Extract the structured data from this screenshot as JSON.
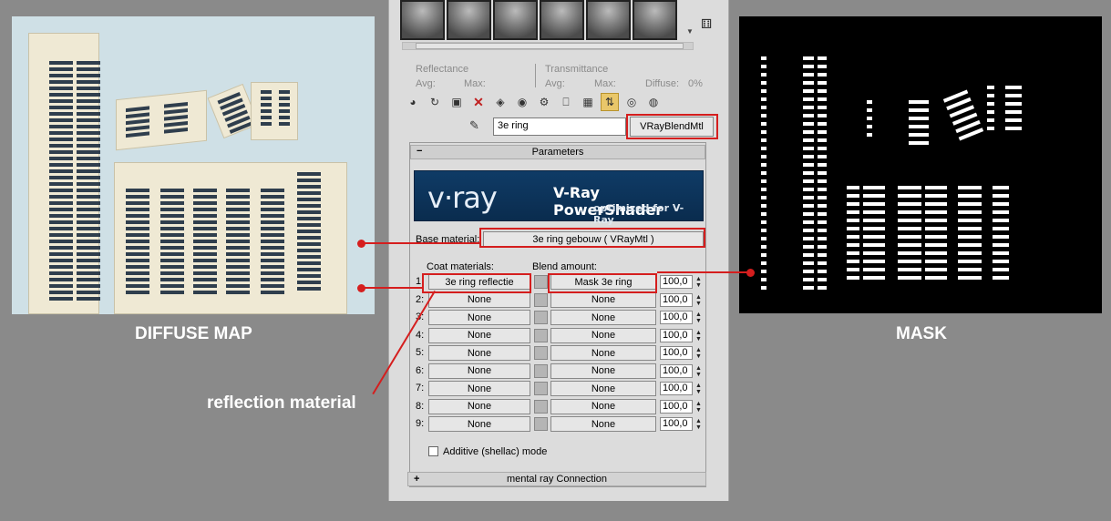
{
  "captions": {
    "diffuse": "DIFFUSE MAP",
    "mask": "MASK",
    "reflection": "reflection material"
  },
  "top": {
    "reflectance": "Reflectance",
    "transmittance": "Transmittance",
    "avg1": "Avg:",
    "max1": "Max:",
    "avg2": "Avg:",
    "max2": "Max:",
    "diffuse": "Diffuse:",
    "diffuse_val": "0%"
  },
  "material": {
    "name": "3e ring",
    "type": "VRayBlendMtl"
  },
  "parameters": {
    "header": "Parameters",
    "collapse": "−",
    "vray_logo": "v·ray",
    "vray_title": "V-Ray PowerShader",
    "vray_subtitle": "optimized for V-Ray",
    "base_label": "Base material:",
    "base_value": "3e ring gebouw  ( VRayMtl )",
    "coat_header": "Coat materials:",
    "blend_header": "Blend amount:",
    "rows": [
      {
        "n": "1:",
        "coat": "3e ring reflectie",
        "blend": "Mask 3e ring",
        "amt": "100,0"
      },
      {
        "n": "2:",
        "coat": "None",
        "blend": "None",
        "amt": "100,0"
      },
      {
        "n": "3:",
        "coat": "None",
        "blend": "None",
        "amt": "100,0"
      },
      {
        "n": "4:",
        "coat": "None",
        "blend": "None",
        "amt": "100,0"
      },
      {
        "n": "5:",
        "coat": "None",
        "blend": "None",
        "amt": "100,0"
      },
      {
        "n": "6:",
        "coat": "None",
        "blend": "None",
        "amt": "100,0"
      },
      {
        "n": "7:",
        "coat": "None",
        "blend": "None",
        "amt": "100,0"
      },
      {
        "n": "8:",
        "coat": "None",
        "blend": "None",
        "amt": "100,0"
      },
      {
        "n": "9:",
        "coat": "None",
        "blend": "None",
        "amt": "100,0"
      }
    ],
    "additive": "Additive (shellac) mode"
  },
  "footer": {
    "sign": "+",
    "label": "mental ray Connection"
  },
  "colors": {
    "highlight": "#d51e1e",
    "active_tool": "#e9c76a",
    "vray_blue": "#0f3b66"
  }
}
